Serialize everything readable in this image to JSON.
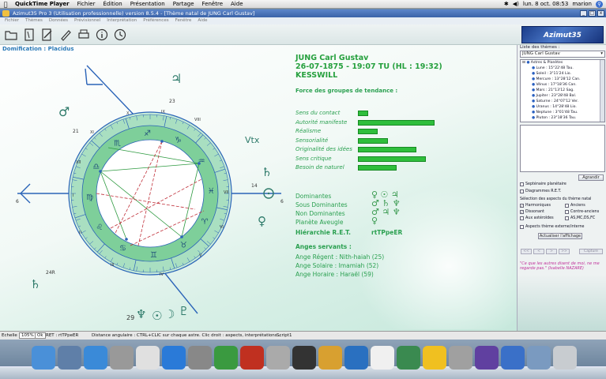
{
  "menubar": {
    "app": "QuickTime Player",
    "items": [
      "Fichier",
      "Édition",
      "Présentation",
      "Partage",
      "Fenêtre",
      "Aide"
    ],
    "clock": "lun. 8 oct. 08:53",
    "user": "marion"
  },
  "window": {
    "title": "Azimut35 Pro 3 (Utilisation professionnelle) version 8.5.4 - [Thème natal de JUNG Carl Gustav]",
    "menu": [
      "Fichier",
      "Thèmes",
      "Données",
      "Prévisionnel",
      "Interprétation",
      "Préférences",
      "Fenêtre",
      "Aide"
    ],
    "logo_text": "Azimut35"
  },
  "chart": {
    "domification_label": "Domification : Placidus",
    "name": "JUNG Carl Gustav",
    "datetime": "26-07-1875 - 19:07 TU (HL : 19:32)",
    "place": "KESSWILL",
    "house_numbers": [
      "I",
      "II",
      "III",
      "IV",
      "V",
      "VI",
      "VII",
      "VIII",
      "IX",
      "X",
      "XI",
      "XII"
    ],
    "degree_labels": [
      "23",
      "21",
      "14",
      "6",
      "6",
      "24R",
      "29"
    ],
    "vertex_label": "Vtx"
  },
  "force": {
    "title": "Force des groupes de tendance :",
    "items": [
      {
        "label": "Sens du contact",
        "value": 0.12
      },
      {
        "label": "Autorité manifeste",
        "value": 0.92
      },
      {
        "label": "Réalisme",
        "value": 0.24
      },
      {
        "label": "Sensorialité",
        "value": 0.36
      },
      {
        "label": "Originalité des idées",
        "value": 0.7
      },
      {
        "label": "Sens critique",
        "value": 0.82
      },
      {
        "label": "Besoin de naturel",
        "value": 0.47
      }
    ]
  },
  "dominants": {
    "rows": [
      {
        "label": "Dominantes",
        "symbols": "♀ ☉ ♃"
      },
      {
        "label": "Sous Dominantes",
        "symbols": "♂ ♄ ♆"
      },
      {
        "label": "Non Dominantes",
        "symbols": "♂ ♃ ♆"
      },
      {
        "label": "Planète Aveugle",
        "symbols": "♀"
      }
    ],
    "ret_label": "Hiérarchie R.E.T.",
    "ret_value": "rtTPpeER"
  },
  "anges": {
    "title": "Anges servants :",
    "items": [
      "Ange Régent : Nith-haiah (25)",
      "Ange Solaire : Imamiah (52)",
      "Ange Horaire : Haraël (59)"
    ]
  },
  "panel": {
    "list_label": "Liste des thèmes :",
    "theme_select": "JUNG Carl Gustav",
    "tree_root": "Astres & Planètes",
    "tree_items": [
      "Lune : 15°22'48 Tau.",
      "Soleil : 3°11'24 Lio.",
      "Mercure : 13°28'12 Can.",
      "Vénus : 17°18'36 Can.",
      "Mars : 21°13'12 Sag.",
      "Jupiter : 23°28'48 Bal.",
      "Saturne : 24°07'12 Ver.",
      "Uranus : 14°28'48 Lio.",
      "Neptune : 3°01'48 Tau.",
      "Pluton : 23°18'36 Tau."
    ],
    "agrandir": "Agrandir",
    "septenaire": "Septénaire planétaire",
    "diagrammes": "Diagrammes R.E.T.",
    "selection_title": "Sélection des aspects du thème natal",
    "aspects": [
      {
        "label": "Harmoniques",
        "checked": true
      },
      {
        "label": "Anciens",
        "checked": false
      },
      {
        "label": "Dissonant",
        "checked": true
      },
      {
        "label": "Contre-anciens",
        "checked": false
      },
      {
        "label": "Aux astéroïdes",
        "checked": false
      },
      {
        "label": "AS,MC,DS,FC",
        "checked": false
      }
    ],
    "aspects_externe": "Aspects thème externe/interne",
    "actualiser": "Actualiser l'affichage",
    "nav": [
      "<<",
      "<",
      ">",
      ">>",
      "Capture"
    ],
    "quote": "\"Ce que les autres disent de moi, ne me regarde pas.\" (Isabelle NAZARE)"
  },
  "status": {
    "echelle_label": "Echelle :",
    "zoom": "105%",
    "ok": "Ok",
    "ret": "RET : rtTPpeER",
    "hint": "Distance angulaire : CTRL+CLIC sur chaque astre. Clic droit : aspects, interprétations...",
    "script": "Script1"
  },
  "dock": [
    "Finder",
    "Aperçu",
    "Safari",
    "Calculatrice",
    "Picasa",
    "iTunes",
    "Préférences Système",
    "Excel",
    "FileZilla",
    "Flip4Mac",
    "Rocket",
    "Ananas",
    "Photoshop",
    "iCal",
    "Gnutella",
    "Sunset",
    "Gallery",
    "iMovie",
    "QuickTime",
    "Documents",
    "Corbeille"
  ]
}
